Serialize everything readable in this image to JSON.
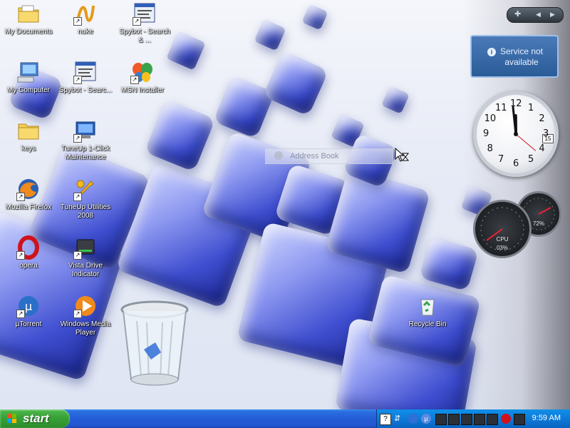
{
  "desktop_icons": [
    {
      "label": "My Documents",
      "icon": "folder-documents-icon"
    },
    {
      "label": "nuke",
      "icon": "nuke-icon"
    },
    {
      "label": "Spybot - Search & ...",
      "icon": "spybot-icon"
    },
    {
      "label": "My Computer",
      "icon": "computer-icon"
    },
    {
      "label": "Spybot - Searc...",
      "icon": "spybot-icon"
    },
    {
      "label": "MSN Installer",
      "icon": "msn-butterfly-icon"
    },
    {
      "label": "keys",
      "icon": "folder-icon"
    },
    {
      "label": "TuneUp 1-Click Maintenance",
      "icon": "tuneup-icon"
    },
    {
      "label": "Mozilla Firefox",
      "icon": "firefox-icon"
    },
    {
      "label": "TuneUp Utilities 2008",
      "icon": "tuneup-utilities-icon"
    },
    {
      "label": "opera",
      "icon": "opera-icon"
    },
    {
      "label": "Vista Drive Indicator",
      "icon": "drive-icon"
    },
    {
      "label": "µTorrent",
      "icon": "utorrent-icon"
    },
    {
      "label": "Windows Media Player",
      "icon": "media-player-icon"
    },
    {
      "label": "Recycle Bin",
      "icon": "recycle-bin-icon"
    }
  ],
  "gadgets": {
    "status_text": "Service not available",
    "clock": {
      "numbers": [
        "12",
        "1",
        "2",
        "3",
        "4",
        "5",
        "6",
        "7",
        "8",
        "9",
        "10",
        "11"
      ],
      "date": "15",
      "hour": 11,
      "minute": 59
    },
    "cpu_meter": {
      "label": "CPU",
      "value": "03%"
    },
    "mem_meter": {
      "value": "72%"
    }
  },
  "address_book_text": "Address Book",
  "taskbar": {
    "start_label": "start",
    "time": "9:59 AM"
  },
  "colors": {
    "taskbar": "#245dd7",
    "start_button": "#39a339",
    "tray": "#0d7ad8"
  }
}
